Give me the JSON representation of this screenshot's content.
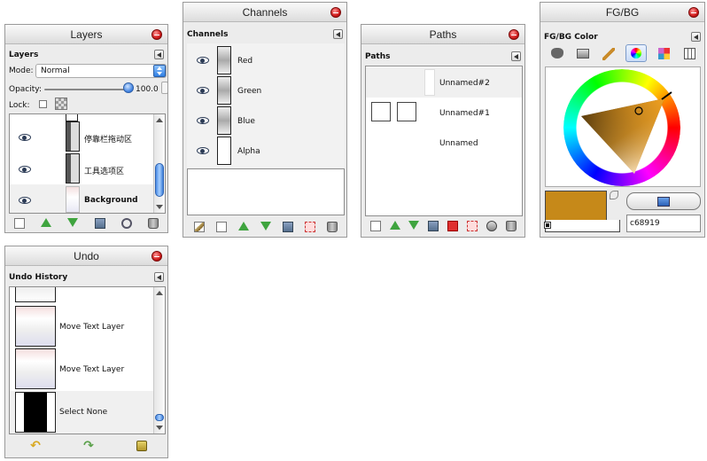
{
  "layers": {
    "title": "Layers",
    "header": "Layers",
    "mode_label": "Mode:",
    "mode_value": "Normal",
    "opacity_label": "Opacity:",
    "opacity_value": "100.0",
    "opacity_percent": 100,
    "lock_label": "Lock:",
    "items": [
      {
        "label": "停靠栏拖动区"
      },
      {
        "label": "工具选项区"
      },
      {
        "label": "Background",
        "selected": true
      }
    ]
  },
  "channels": {
    "title": "Channels",
    "header": "Channels",
    "items": [
      {
        "label": "Red"
      },
      {
        "label": "Green"
      },
      {
        "label": "Blue"
      },
      {
        "label": "Alpha"
      }
    ]
  },
  "paths": {
    "title": "Paths",
    "header": "Paths",
    "items": [
      {
        "label": "Unnamed#2"
      },
      {
        "label": "Unnamed#1"
      },
      {
        "label": "Unnamed"
      }
    ]
  },
  "fgbg": {
    "title": "FG/BG",
    "header": "FG/BG Color",
    "hex_value": "c68919",
    "fg_color": "#c68919",
    "bg_color": "#ffffff",
    "tabs": [
      "gimp-icon",
      "scanner-icon",
      "brush-icon",
      "color-wheel-icon",
      "palette-icon",
      "scales-icon"
    ]
  },
  "undo": {
    "title": "Undo",
    "header": "Undo History",
    "items": [
      {
        "label": "Move Text Layer"
      },
      {
        "label": "Move Text Layer"
      },
      {
        "label": "Select None",
        "selected": true
      }
    ]
  }
}
